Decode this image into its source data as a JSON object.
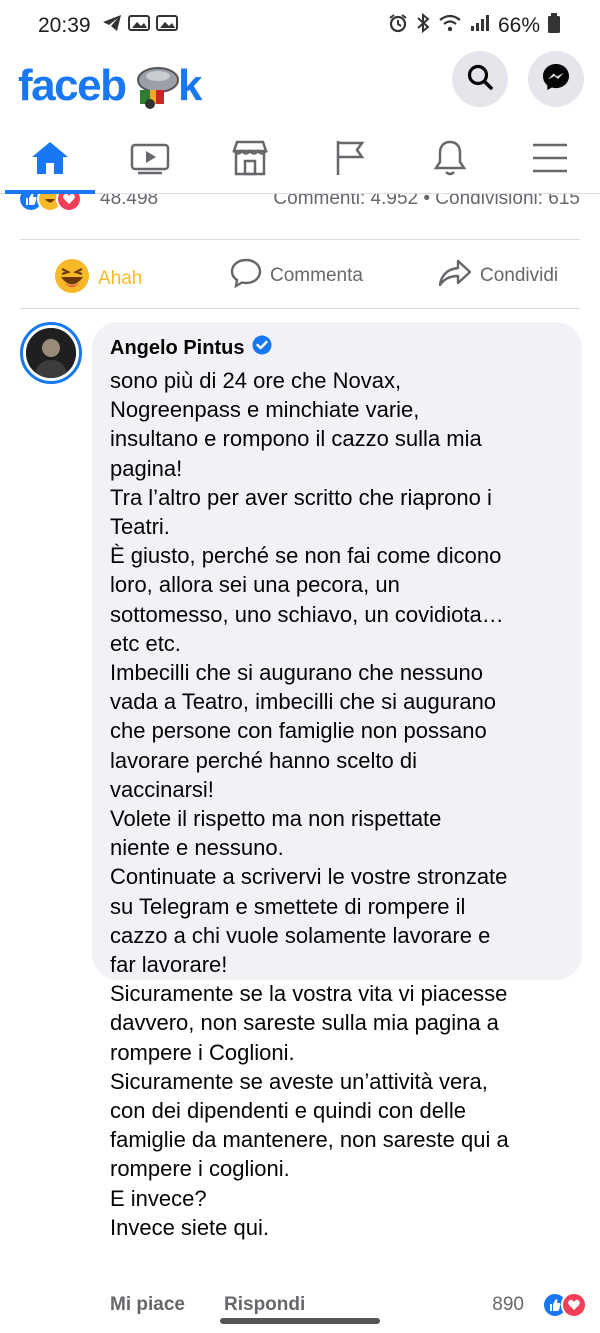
{
  "status": {
    "time": "20:39",
    "battery": "66%"
  },
  "header": {
    "logo_text": "facebook",
    "brand_color": "#1877f2"
  },
  "tabs": [
    {
      "name": "home",
      "active": true
    },
    {
      "name": "watch",
      "active": false
    },
    {
      "name": "marketplace",
      "active": false
    },
    {
      "name": "pages",
      "active": false
    },
    {
      "name": "notifications",
      "active": false
    },
    {
      "name": "menu",
      "active": false
    }
  ],
  "post_summary": {
    "reaction_count": "48.498",
    "comments_shares": "Commenti: 4.952 • Condivisioni: 615"
  },
  "actions": {
    "react_label": "Ahah",
    "comment_label": "Commenta",
    "share_label": "Condividi"
  },
  "comment": {
    "author": "Angelo Pintus",
    "verified": true,
    "lines": [
      "sono più di 24 ore che Novax,",
      "Nogreenpass e minchiate varie,",
      "insultano e rompono il cazzo sulla mia",
      "pagina!",
      "Tra l’altro per aver scritto che riaprono i",
      "Teatri.",
      "È giusto, perché se non fai come dicono",
      "loro, allora sei una pecora, un",
      "sottomesso, uno schiavo, un covidiota…",
      "etc etc.",
      "Imbecilli che si augurano che nessuno",
      "vada a Teatro, imbecilli che si augurano",
      "che persone con famiglie non possano",
      "lavorare perché hanno scelto di",
      "vaccinarsi!",
      "Volete il rispetto ma non rispettate",
      "niente e nessuno.",
      "Continuate a scrivervi le vostre stronzate",
      "su Telegram e smettete di rompere il",
      "cazzo a chi vuole solamente lavorare e",
      "far lavorare!",
      "Sicuramente se la vostra vita vi piacesse",
      "davvero, non sareste sulla mia pagina a",
      "rompere i Coglioni.",
      "Sicuramente se aveste un’attività vera,",
      "con dei dipendenti e quindi con delle",
      "famiglie da mantenere, non sareste qui a",
      "rompere i coglioni.",
      "E invece?",
      "Invece siete qui."
    ],
    "like_label": "Mi piace",
    "reply_label": "Rispondi",
    "reaction_count": "890"
  }
}
